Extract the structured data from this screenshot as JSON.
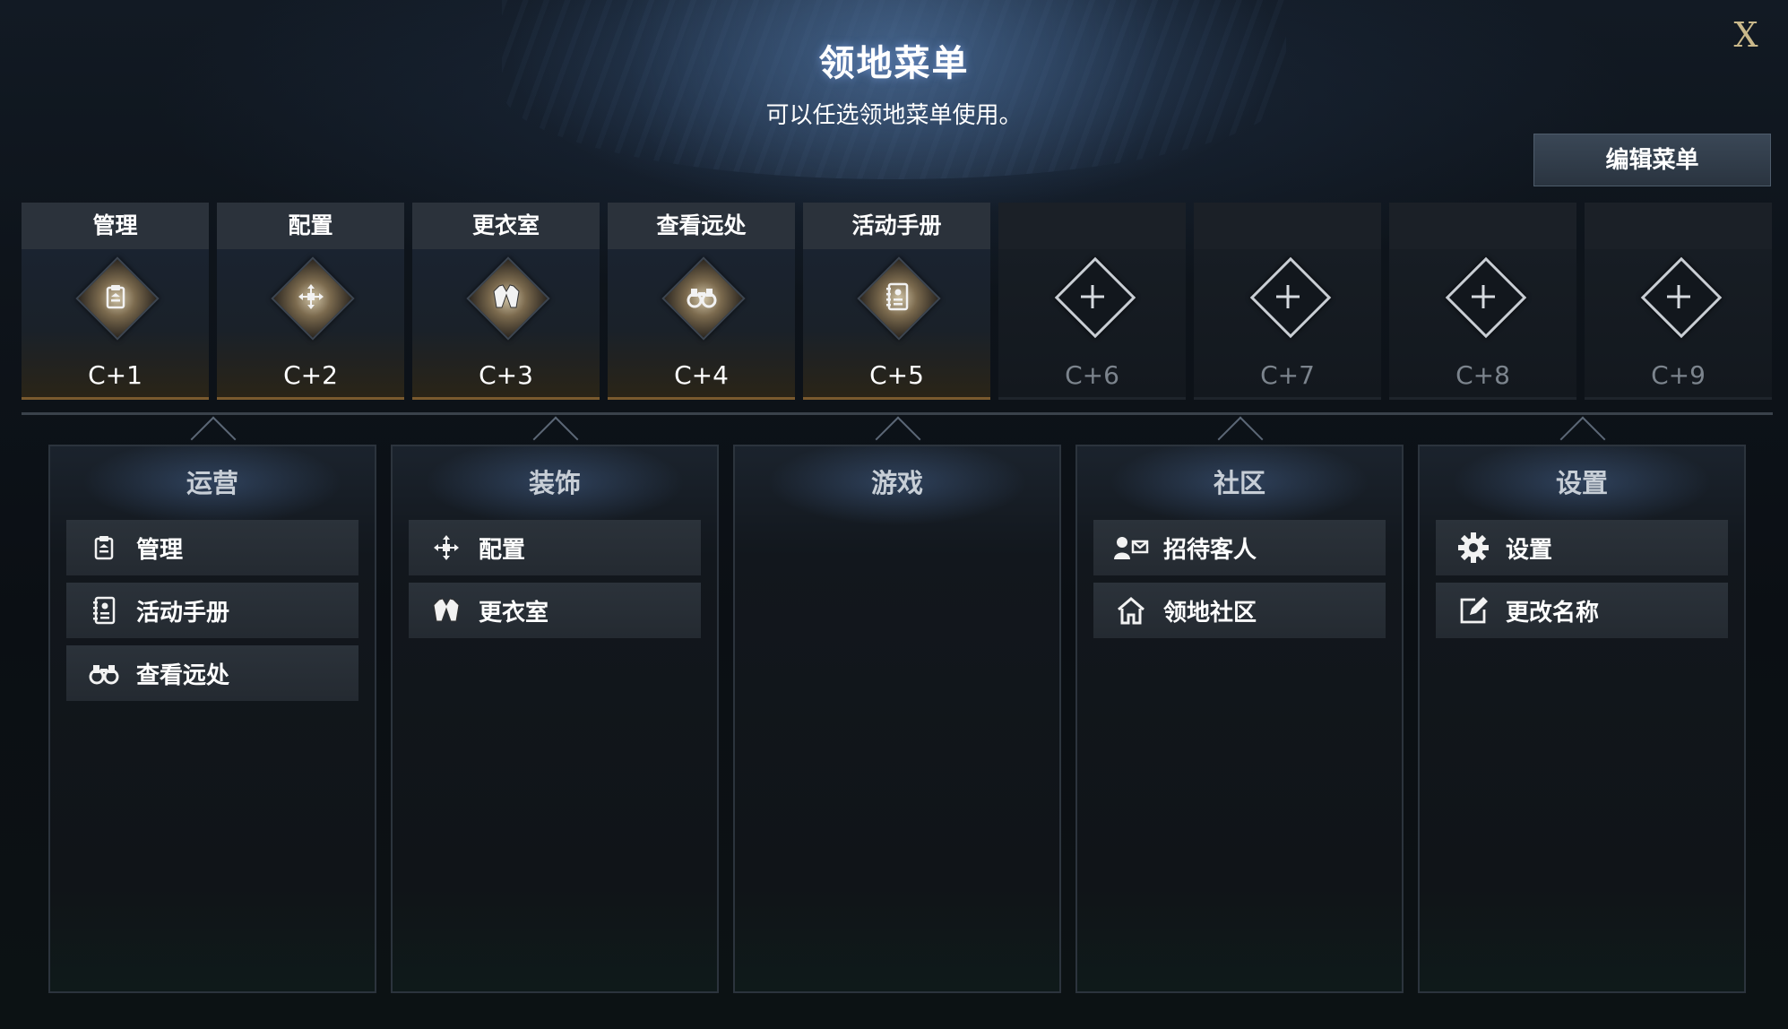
{
  "header": {
    "title": "领地菜单",
    "subtitle": "可以任选领地菜单使用。",
    "close_label": "X",
    "edit_label": "编辑菜单"
  },
  "slots": [
    {
      "label": "管理",
      "key": "C+1",
      "icon": "clipboard-icon"
    },
    {
      "label": "配置",
      "key": "C+2",
      "icon": "move-arrows-icon"
    },
    {
      "label": "更衣室",
      "key": "C+3",
      "icon": "jacket-icon"
    },
    {
      "label": "查看远处",
      "key": "C+4",
      "icon": "binoculars-icon"
    },
    {
      "label": "活动手册",
      "key": "C+5",
      "icon": "notebook-icon"
    },
    {
      "label": "",
      "key": "C+6",
      "icon": "plus-icon"
    },
    {
      "label": "",
      "key": "C+7",
      "icon": "plus-icon"
    },
    {
      "label": "",
      "key": "C+8",
      "icon": "plus-icon"
    },
    {
      "label": "",
      "key": "C+9",
      "icon": "plus-icon"
    }
  ],
  "categories": [
    {
      "title": "运营",
      "items": [
        {
          "label": "管理",
          "icon": "clipboard-icon"
        },
        {
          "label": "活动手册",
          "icon": "notebook-icon"
        },
        {
          "label": "查看远处",
          "icon": "binoculars-icon"
        }
      ]
    },
    {
      "title": "装饰",
      "items": [
        {
          "label": "配置",
          "icon": "move-arrows-icon"
        },
        {
          "label": "更衣室",
          "icon": "jacket-icon"
        }
      ]
    },
    {
      "title": "游戏",
      "items": []
    },
    {
      "title": "社区",
      "items": [
        {
          "label": "招待客人",
          "icon": "invite-guest-icon"
        },
        {
          "label": "领地社区",
          "icon": "home-community-icon"
        }
      ]
    },
    {
      "title": "设置",
      "items": [
        {
          "label": "设置",
          "icon": "gear-icon"
        },
        {
          "label": "更改名称",
          "icon": "edit-name-icon"
        }
      ]
    }
  ],
  "colors": {
    "accent_gold": "#7a5a2e",
    "close_gold": "#c9b88a",
    "inactive_key": "#7c848d"
  }
}
